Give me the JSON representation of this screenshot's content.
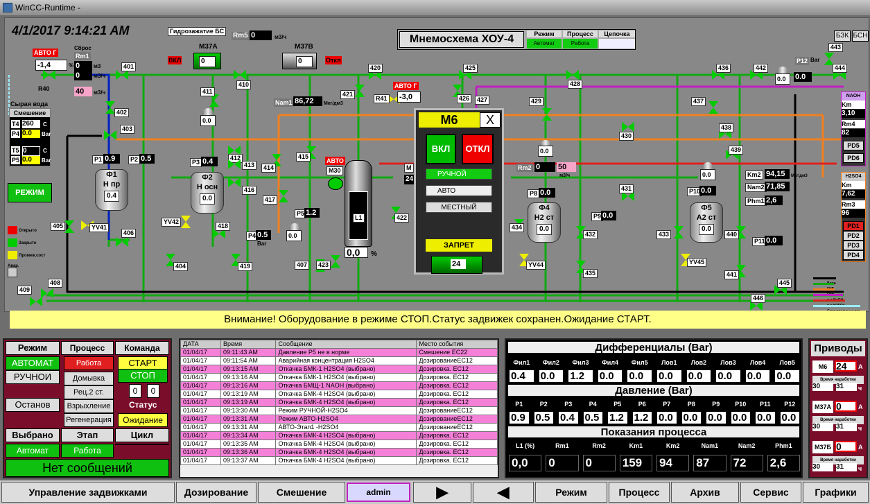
{
  "window": {
    "title": "WinCC-Runtime -"
  },
  "clock": "4/1/2017 9:14:21 AM",
  "scheme": {
    "title": "Мнемосхема ХОУ-4",
    "mode_label": "Режим",
    "mode_value": "Автомат",
    "process_label": "Процесс",
    "process_value": "Работа",
    "chain_label": "Цепочка",
    "chain_value": "",
    "btn_bzk": "БЗК",
    "btn_bsn": "БСН"
  },
  "top": {
    "hydro": "Гидрозажатие БС",
    "rm5": "Rm5",
    "rm5_val": "0",
    "rm5_unit": "м3/ч",
    "m37a": "M37A",
    "m37a_val": "0",
    "m37b": "M37B",
    "m37b_val": "0",
    "vkl": "ВКЛ",
    "otkl": "Откл"
  },
  "left": {
    "avto": "АВТО Г",
    "reset": "Сброс",
    "rm1": "Rm1",
    "r40_val": "-1,4",
    "r40_unit": "%",
    "r40": "R40",
    "rm1_val": "0",
    "rm1_unit": "м3",
    "rm1_val2": "0",
    "rm1_unit2": "м3/ч",
    "rm1_val3": "40",
    "rm1_unit3": "м3/ч",
    "raw": "Сырая вода",
    "mix": "Смешение",
    "t4": "T4",
    "t4_val": "260",
    "t4_unit": "C",
    "p4": "P4",
    "p4_val": "0.0",
    "p4_unit": "Bar",
    "t5": "T5",
    "t5_val": "0",
    "t5_unit": "C",
    "p5": "P5",
    "p5_val": "0.0",
    "p5_unit": "Bar",
    "mode_btn": "РЕЖИМ",
    "leg_open": "Открыто",
    "leg_closed": "Закрыто",
    "leg_mid": "Промеж.сост",
    "leg_alarm": "Авар."
  },
  "valves": [
    "401",
    "402",
    "403",
    "404",
    "405",
    "406",
    "407",
    "408",
    "409",
    "410",
    "411",
    "412",
    "413",
    "414",
    "415",
    "416",
    "417",
    "418",
    "419",
    "420",
    "421",
    "422",
    "423",
    "425",
    "426",
    "427",
    "428",
    "429",
    "430",
    "431",
    "432",
    "433",
    "434",
    "435",
    "436",
    "437",
    "438",
    "439",
    "440",
    "441",
    "442",
    "443",
    "444",
    "445",
    "446",
    "YV41",
    "YV42",
    "YV44",
    "YV45"
  ],
  "tanks": [
    {
      "name": "Ф1",
      "sub": "Н пр",
      "val": "0.4",
      "p": "P1",
      "pv": "0.9"
    },
    {
      "name": "Ф2",
      "sub": "Н осн",
      "val": "0.0",
      "p": "P3",
      "pv": "0.4"
    },
    {
      "name": "Ф4",
      "sub": "Н2 ст",
      "val": "0.0",
      "p": "P8",
      "pv": "0.0"
    },
    {
      "name": "Ф5",
      "sub": "А2 ст",
      "val": "0.0",
      "p": "P10",
      "pv": "0.0"
    }
  ],
  "mid": {
    "nam1": "Nam1",
    "nam1_val": "86,72",
    "nam1_unit": "Мкг/дм3",
    "r41": "R41",
    "r41_val": "-3,0",
    "r41_avto": "АВТО Г",
    "p2": "P2",
    "p2_val": "0.5",
    "p4b": "P4",
    "p4b_val": "0.5",
    "p4b_unit": "Bar",
    "p5b": "P5",
    "p5b_val": "1.2",
    "m30": "M30",
    "avto2": "АВТО",
    "l1": "L1",
    "l1_val": "0,0",
    "l1_unit": "%",
    "m_small": "M",
    "m_small_val": "24",
    "gauge_val1": "0.0",
    "gauge_val2": "0.0",
    "gauge_val3": "0.0",
    "gauge_val4": "0.0",
    "gauge_val5": "0.0",
    "rm2": "Rm2",
    "rm2_val": "0",
    "rm2_val2": "50",
    "rm2_unit": "м3/ч",
    "p9": "P9",
    "p9_val": "0.0",
    "p11": "P11",
    "p11_val": "0.0",
    "p12": "P12",
    "p12_val": "0.0",
    "p12_unit": "Bar",
    "km2": "Km2",
    "km2_val": "94,15",
    "km2_unit": "Мкг/дм3",
    "nam2": "Nam2",
    "nam2_val": "71,85",
    "phm1": "Phm1",
    "phm1_val": "2,6"
  },
  "naoh": {
    "title": "NAOH",
    "km": "Km",
    "km_val": "3,10",
    "rm4": "Rm4",
    "rm4_val": "82",
    "pd5": "PD5",
    "pd6": "PD6"
  },
  "h2so4": {
    "title": "H2SO4",
    "km": "Km",
    "km_val": "7,62",
    "rm3": "Rm3",
    "rm3_val": "96",
    "pd1": "PD1",
    "pd2": "PD2",
    "pd3": "PD3",
    "pd4": "PD4"
  },
  "legend": [
    "Вода",
    "КНБ",
    "Обв.",
    "р-р NaOH",
    "р-р H2SO4",
    "Сжат.воздух на рег."
  ],
  "m6": {
    "title": "M6",
    "close": "X",
    "on": "ВКЛ",
    "off": "ОТКЛ",
    "manual": "РУЧНОЙ",
    "auto": "АВТО",
    "local": "МЕСТНЫЙ",
    "ban": "ЗАПРЕТ",
    "val": "24"
  },
  "alarm": "Внимание! Оборудование в режиме СТОП.Статус задвижек сохранен.Ожидание СТАРТ.",
  "ctrl": {
    "mode": "Режим",
    "process": "Процесс",
    "command": "Команда",
    "auto": "АВТОМАТ",
    "manual": "РУЧНОИ",
    "stop_mode": "Останов",
    "work": "Работа",
    "domyvka": "Домывка",
    "rec": "Рец.2 ст.",
    "vzryhl": "Взрыхление",
    "regen": "Регенерация",
    "start": "СТАРТ",
    "stop": "СТОП",
    "c1": "0",
    "c2": "0",
    "status": "Статус",
    "wait": "Ожидание",
    "selected": "Выбрано",
    "stage": "Этап",
    "cycle": "Цикл",
    "sel_val": "Автомат",
    "stage_val": "Работа",
    "cycle_val": "",
    "nomsg": "Нет сообщений"
  },
  "log": {
    "headers": [
      "ДАТА",
      "Время",
      "Сообщение",
      "Место события"
    ],
    "rows": [
      [
        "01/04/17",
        "09:11:43 AM",
        "Давление Р5 не в норме",
        "Смешение ЕС22"
      ],
      [
        "01/04/17",
        "09:11:54 AM",
        "Аварийная концентрация H2SO4",
        "ДозированиеЕС12"
      ],
      [
        "01/04/17",
        "09:13:15 AM",
        "Откачка БМК-1 H2SO4 (выбрано)",
        "Дозировка. ЕС12"
      ],
      [
        "01/04/17",
        "09:13:16 AM",
        "Откачка БМК-1 H2SO4 (выбрано)",
        "Дозировка. ЕС12"
      ],
      [
        "01/04/17",
        "09:13:16 AM",
        "Откачка БМЩ-1 NAOH (выбрано)",
        "Дозировка. ЕС12"
      ],
      [
        "01/04/17",
        "09:13:19 AM",
        "Откачка БМК-4 H2SO4 (выбрано)",
        "Дозировка. ЕС12"
      ],
      [
        "01/04/17",
        "09:13:19 AM",
        "Откачка БМК-4 H2SO4 (выбрано)",
        "Дозировка. ЕС12"
      ],
      [
        "01/04/17",
        "09:13:30 AM",
        "Режим РУЧНОЙ-H2SO4",
        "ДозированиеЕС12"
      ],
      [
        "01/04/17",
        "09:13:31 AM",
        "Режим АВТО-H2SO4",
        "ДозированиеЕС12"
      ],
      [
        "01/04/17",
        "09:13:31 AM",
        "АВТО-Этап1 -H2SO4",
        "ДозированиеЕС12"
      ],
      [
        "01/04/17",
        "09:13:34 AM",
        "Откачка БМК-4 H2SO4 (выбрано)",
        "Дозировка. ЕС12"
      ],
      [
        "01/04/17",
        "09:13:35 AM",
        "Откачка БМК-4 H2SO4 (выбрано)",
        "Дозировка. ЕС12"
      ],
      [
        "01/04/17",
        "09:13:36 AM",
        "Откачка БМК-4 H2SO4 (выбрано)",
        "Дозировка. ЕС12"
      ],
      [
        "01/04/17",
        "09:13:37 AM",
        "Откачка БМК-4 H2SO4 (выбрано)",
        "Дозировка. ЕС12"
      ]
    ]
  },
  "diff": {
    "title": "Дифференциалы (Bar)",
    "labels": [
      "Фил1",
      "Фил2",
      "Фил3",
      "Фил4",
      "Фил5",
      "Лов1",
      "Лов2",
      "Лов3",
      "Лов4",
      "Лов5"
    ],
    "values": [
      "0.4",
      "0.0",
      "1.2",
      "0.0",
      "0.0",
      "0.0",
      "0.0",
      "0.0",
      "0.0",
      "0.0"
    ]
  },
  "press": {
    "title": "Давление (Bar)",
    "labels": [
      "P1",
      "P2",
      "P3",
      "P4",
      "P5",
      "P6",
      "P7",
      "P8",
      "P9",
      "P10",
      "P11",
      "P12"
    ],
    "values": [
      "0.9",
      "0.5",
      "0.4",
      "0.5",
      "1.2",
      "1.2",
      "0.0",
      "0.0",
      "0.0",
      "0.0",
      "0.0",
      "0.0"
    ]
  },
  "proc": {
    "title": "Показания процесса",
    "labels": [
      "L1 (%)",
      "Rm1",
      "Rm2",
      "Km1",
      "Km2",
      "Nam1",
      "Nam2",
      "Phm1"
    ],
    "values": [
      "0,0",
      "0",
      "0",
      "159",
      "94",
      "87",
      "72",
      "2,6"
    ]
  },
  "drives": {
    "title": "Приводы",
    "items": [
      {
        "name": "M6",
        "val": "24",
        "unit": "A",
        "run": "Время наработки",
        "h1": "30",
        "h2": "31",
        "hu": "ч"
      },
      {
        "name": "M37A",
        "val": "0",
        "unit": "A",
        "run": "Время наработки",
        "h1": "30",
        "h2": "31",
        "hu": "ч"
      },
      {
        "name": "M37Б",
        "val": "0",
        "unit": "A",
        "run": "Время наработки",
        "h1": "30",
        "h2": "31",
        "hu": "ч"
      }
    ]
  },
  "nav": {
    "valves": "Управление задвижками",
    "dosing": "Дозирование",
    "mixing": "Смешение",
    "user": "admin",
    "fwd": "▶",
    "back": "◀",
    "mode": "Режим",
    "process": "Процесс",
    "archive": "Архив",
    "service": "Сервис",
    "graphs": "Графики"
  }
}
